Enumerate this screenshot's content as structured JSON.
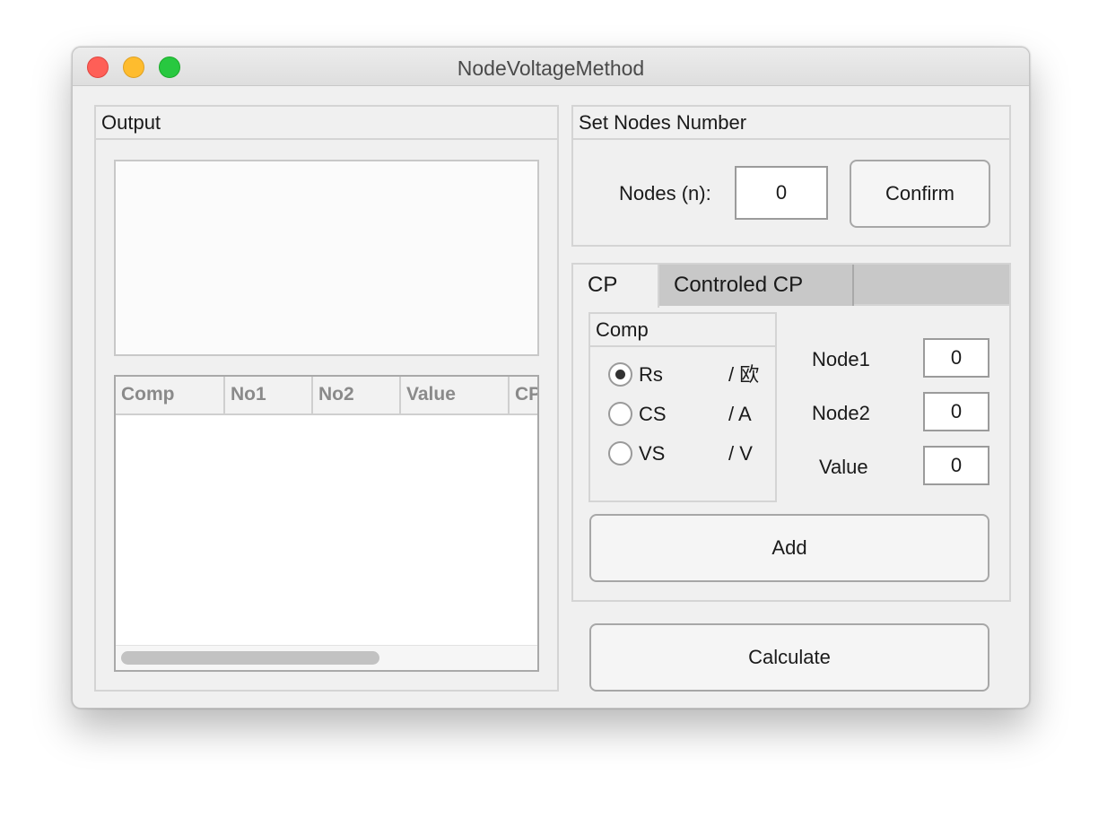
{
  "window": {
    "title": "NodeVoltageMethod"
  },
  "output_panel": {
    "title": "Output",
    "text": "",
    "table": {
      "columns": [
        "Comp",
        "No1",
        "No2",
        "Value",
        "CP"
      ],
      "rows": []
    }
  },
  "nodes_panel": {
    "title": "Set Nodes Number",
    "nodes_label": "Nodes (n):",
    "nodes_value": "0",
    "confirm_label": "Confirm"
  },
  "tabs": {
    "items": [
      "CP",
      "Controled CP"
    ],
    "active": "CP"
  },
  "comp_group": {
    "title": "Comp",
    "options": [
      {
        "label": "Rs",
        "unit": "/ 欧",
        "selected": true
      },
      {
        "label": "CS",
        "unit": "/ A",
        "selected": false
      },
      {
        "label": "VS",
        "unit": "/ V",
        "selected": false
      }
    ]
  },
  "fields": {
    "node1_label": "Node1",
    "node1_value": "0",
    "node2_label": "Node2",
    "node2_value": "0",
    "value_label": "Value",
    "value_value": "0"
  },
  "buttons": {
    "add_label": "Add",
    "calculate_label": "Calculate"
  }
}
